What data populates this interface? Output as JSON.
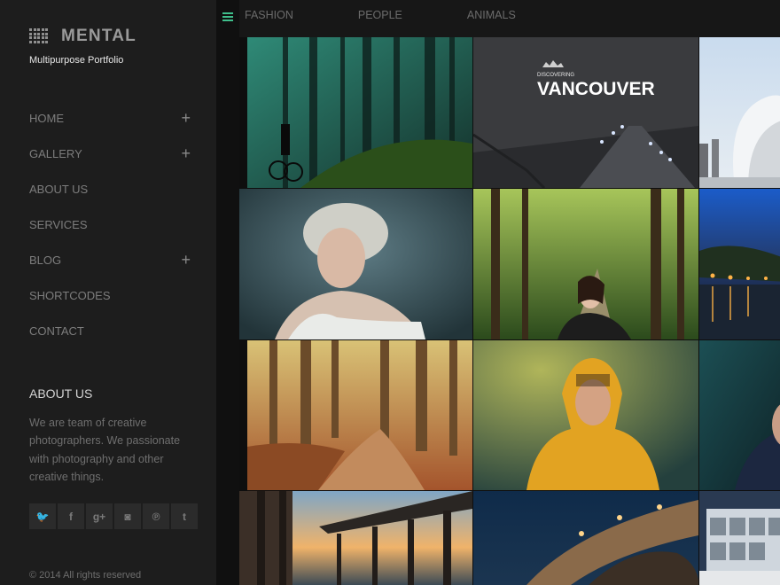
{
  "brand": {
    "name": "MENTAL",
    "tagline": "Multipurpose Portfolio"
  },
  "nav": [
    {
      "label": "HOME",
      "expandable": true
    },
    {
      "label": "GALLERY",
      "expandable": true
    },
    {
      "label": "ABOUT US",
      "expandable": false
    },
    {
      "label": "SERVICES",
      "expandable": false
    },
    {
      "label": "BLOG",
      "expandable": true
    },
    {
      "label": "SHORTCODES",
      "expandable": false
    },
    {
      "label": "CONTACT",
      "expandable": false
    }
  ],
  "about": {
    "title": "ABOUT US",
    "text": "We are team of creative photographers. We passionate with photography and other creative things."
  },
  "social": [
    {
      "icon": "twitter-icon",
      "glyph": "🐦"
    },
    {
      "icon": "facebook-icon",
      "glyph": "f"
    },
    {
      "icon": "google-plus-icon",
      "glyph": "g+"
    },
    {
      "icon": "instagram-icon",
      "glyph": "◙"
    },
    {
      "icon": "pinterest-icon",
      "glyph": "℗"
    },
    {
      "icon": "tumblr-icon",
      "glyph": "t"
    }
  ],
  "copyright": "© 2014 All rights reserved",
  "filters": [
    "FASHION",
    "PEOPLE",
    "ANIMALS"
  ],
  "gallery": {
    "vancouver_text": {
      "small": "DISCOVERING",
      "big": "VANCOUVER"
    }
  }
}
